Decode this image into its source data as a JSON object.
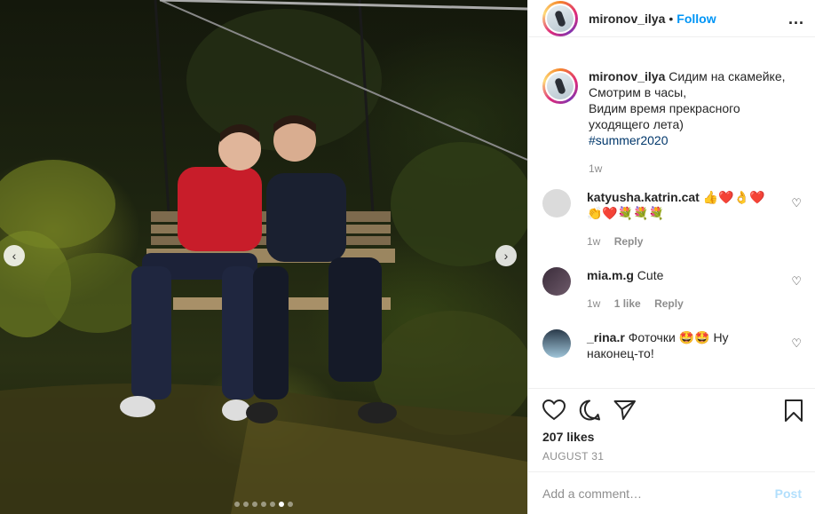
{
  "photo": {
    "nav_left_icon": "chevron-left-icon",
    "nav_right_icon": "chevron-right-icon",
    "carousel": {
      "total": 7,
      "active_index": 5
    }
  },
  "header": {
    "username": "mironov_ilya",
    "separator": "•",
    "follow_label": "Follow",
    "more_label": "..."
  },
  "caption": {
    "username": "mironov_ilya",
    "lines": [
      "Сидим на скамейке,",
      "Смотрим в часы,",
      "Видим время прекрасного",
      "уходящего лета)"
    ],
    "hashtag": "#summer2020",
    "time": "1w"
  },
  "comments": [
    {
      "username": "katyusha.katrin.cat",
      "text": "👍❤️👌❤️",
      "text2": "👏❤️💐💐💐",
      "time": "1w",
      "likes": "",
      "reply_label": "Reply"
    },
    {
      "username": "mia.m.g",
      "text": "Cute",
      "text2": "",
      "time": "1w",
      "likes": "1 like",
      "reply_label": "Reply"
    },
    {
      "username": "_rina.r",
      "text": "Фоточки 🤩🤩 Ну",
      "text2": "наконец-то!",
      "time": "",
      "likes": "",
      "reply_label": ""
    }
  ],
  "likes_text": "207 likes",
  "date_text": "AUGUST 31",
  "add_comment": {
    "placeholder": "Add a comment…",
    "post_label": "Post"
  },
  "colors": {
    "accent": "#0095f6",
    "post_disabled": "#b2dffc",
    "muted": "#8e8e8e",
    "text": "#262626"
  }
}
